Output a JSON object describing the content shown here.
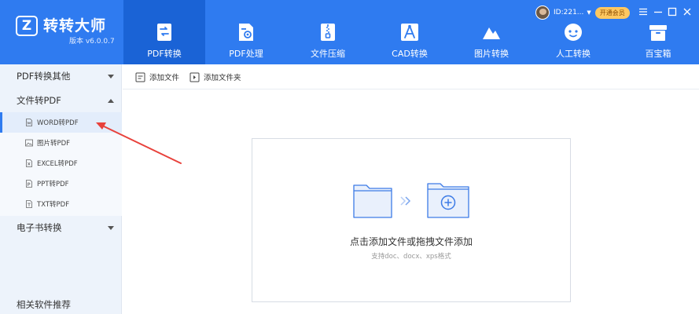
{
  "app": {
    "logo_letter": "Z",
    "title": "转转大师",
    "version": "版本 v6.0.0.7"
  },
  "nav_tabs": [
    {
      "label": "PDF转换",
      "icon": "pdf-convert-icon",
      "active": true
    },
    {
      "label": "PDF处理",
      "icon": "pdf-process-icon",
      "active": false
    },
    {
      "label": "文件压缩",
      "icon": "zip-icon",
      "active": false
    },
    {
      "label": "CAD转换",
      "icon": "cad-icon",
      "active": false
    },
    {
      "label": "图片转换",
      "icon": "image-convert-icon",
      "active": false
    },
    {
      "label": "人工转换",
      "icon": "manual-icon",
      "active": false
    },
    {
      "label": "百宝箱",
      "icon": "toolbox-icon",
      "active": false
    }
  ],
  "user": {
    "id": "ID:221...",
    "vip_label": "开通会员"
  },
  "sidebar": {
    "groups": [
      {
        "label": "PDF转换其他",
        "expanded": false
      },
      {
        "label": "文件转PDF",
        "expanded": true
      },
      {
        "label": "电子书转换",
        "expanded": false
      }
    ],
    "items": [
      {
        "label": "WORD转PDF",
        "icon": "word-file-icon",
        "active": true
      },
      {
        "label": "图片转PDF",
        "icon": "image-file-icon",
        "active": false
      },
      {
        "label": "EXCEL转PDF",
        "icon": "excel-file-icon",
        "active": false
      },
      {
        "label": "PPT转PDF",
        "icon": "ppt-file-icon",
        "active": false
      },
      {
        "label": "TXT转PDF",
        "icon": "txt-file-icon",
        "active": false
      }
    ],
    "related": "相关软件推荐"
  },
  "toolbar": {
    "add_file": "添加文件",
    "add_folder": "添加文件夹"
  },
  "dropzone": {
    "title": "点击添加文件或拖拽文件添加",
    "hint": "支持doc、docx、xps格式"
  },
  "colors": {
    "header_blue": "#2f7bf0",
    "active_tab": "#1a63d6",
    "sidebar_bg": "#edf3fb",
    "annotation_red": "#e8413b",
    "folder_fill": "#e9f0fc",
    "folder_stroke": "#3d7be6"
  }
}
